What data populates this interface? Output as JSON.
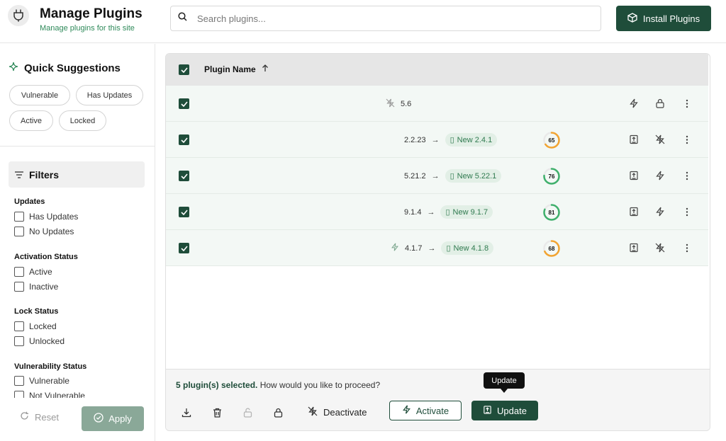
{
  "header": {
    "title": "Manage Plugins",
    "subtitle": "Manage plugins for this site",
    "search_placeholder": "Search plugins...",
    "install_label": "Install Plugins"
  },
  "sidebar": {
    "quick_title": "Quick Suggestions",
    "chips": [
      "Vulnerable",
      "Has Updates",
      "Active",
      "Locked"
    ],
    "filters_title": "Filters",
    "groups": [
      {
        "title": "Updates",
        "options": [
          "Has Updates",
          "No Updates"
        ]
      },
      {
        "title": "Activation Status",
        "options": [
          "Active",
          "Inactive"
        ]
      },
      {
        "title": "Lock Status",
        "options": [
          "Locked",
          "Unlocked"
        ]
      },
      {
        "title": "Vulnerability Status",
        "options": [
          "Vulnerable",
          "Not Vulnerable"
        ]
      }
    ],
    "reset_label": "Reset",
    "apply_label": "Apply"
  },
  "table": {
    "header_label": "Plugin Name",
    "rows": [
      {
        "version": "5.6",
        "new_version": "",
        "score": null,
        "lead_icon": "no-flash-icon",
        "toggle_icon": "flash-icon",
        "middle_icon": "lock-icon"
      },
      {
        "version": "2.2.23",
        "new_version": "New 2.4.1",
        "score": 65,
        "lead_icon": "",
        "toggle_icon": "update-icon",
        "middle_icon": "no-flash-icon"
      },
      {
        "version": "5.21.2",
        "new_version": "New 5.22.1",
        "score": 76,
        "lead_icon": "",
        "toggle_icon": "update-icon",
        "middle_icon": "flash-icon"
      },
      {
        "version": "9.1.4",
        "new_version": "New 9.1.7",
        "score": 81,
        "lead_icon": "",
        "toggle_icon": "update-icon",
        "middle_icon": "flash-icon"
      },
      {
        "version": "4.1.7",
        "new_version": "New 4.1.8",
        "score": 68,
        "lead_icon": "flash-icon",
        "toggle_icon": "update-icon",
        "middle_icon": "no-flash-icon"
      }
    ]
  },
  "footer": {
    "selected_count": "5 plugin(s) selected.",
    "prompt": "How would you like to proceed?",
    "deactivate_label": "Deactivate",
    "activate_label": "Activate",
    "update_label": "Update",
    "tooltip": "Update"
  },
  "colors": {
    "brand": "#1f4d3a",
    "accent_green": "#2f8a5a",
    "score_orange": "#f2a431",
    "score_green": "#3fb06c"
  }
}
